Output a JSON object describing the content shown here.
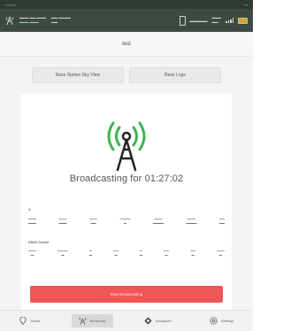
{
  "header": {
    "title": "test",
    "tabs": [
      {
        "label": "Base Station Sky View"
      },
      {
        "label": "Base Logs"
      }
    ]
  },
  "broadcast": {
    "status_text": "Broadcasting for 01:27:02",
    "stop_label": "Stop Broadcasting"
  },
  "sections": {
    "position_label": "A",
    "gnss_label": "GNSS Control"
  },
  "bottom_nav": [
    {
      "label": "Home",
      "icon": "map-pin-icon"
    },
    {
      "label": "Broadcast",
      "icon": "antenna-icon"
    },
    {
      "label": "Advanced",
      "icon": "advanced-icon"
    },
    {
      "label": "Settings",
      "icon": "gear-icon"
    }
  ],
  "colors": {
    "accent_green": "#3fb34f",
    "stop_red": "#ef5656",
    "header_bg": "#3d4a42"
  }
}
